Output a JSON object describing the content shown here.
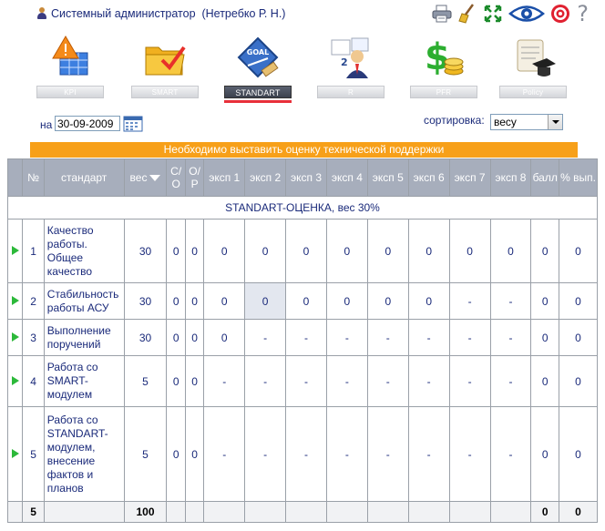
{
  "header": {
    "user_text": "Системный администратор  (Нетребко Р. Н.)",
    "tools": [
      "printer-icon",
      "broom-icon",
      "expand-icon",
      "eye-icon",
      "target-icon",
      "help-icon"
    ],
    "help_label": "?"
  },
  "modules": [
    {
      "label": "KPI",
      "icon": "warning-table-icon",
      "active": false
    },
    {
      "label": "SMART",
      "icon": "folder-check-icon",
      "active": false
    },
    {
      "label": "STANDART",
      "icon": "goal-sign-icon",
      "active": true
    },
    {
      "label": "R",
      "icon": "team-icon",
      "active": false
    },
    {
      "label": "PFR",
      "icon": "dollar-coins-icon",
      "active": false
    },
    {
      "label": "Policy",
      "icon": "scroll-cap-icon",
      "active": false
    }
  ],
  "controls": {
    "date_prefix": "на",
    "date_value": "30-09-2009",
    "sort_label": "сортировка:",
    "sort_value": "весу"
  },
  "warning": "Необходимо выставить оценку технической поддержки",
  "table": {
    "headers": {
      "num": "№",
      "standard": "стандарт",
      "weight": "вес",
      "so": "С/\nО",
      "op": "О/\nР",
      "e1": "эксп 1",
      "e2": "эксп 2",
      "e3": "эксп 3",
      "e4": "эксп 4",
      "e5": "эксп 5",
      "e6": "эксп 6",
      "e7": "эксп 7",
      "e8": "эксп 8",
      "score": "балл",
      "pct": "% вып."
    },
    "section": "STANDART-ОЦЕНКА, вес 30%",
    "rows": [
      {
        "n": "1",
        "name": "Качество работы. Общее качество",
        "w": "30",
        "so": "0",
        "op": "0",
        "e": [
          "0",
          "0",
          "0",
          "0",
          "0",
          "0",
          "0",
          "0"
        ],
        "score": "0",
        "pct": "0"
      },
      {
        "n": "2",
        "name": "Стабильность работы АСУ",
        "w": "30",
        "so": "0",
        "op": "0",
        "e": [
          "0",
          "0",
          "0",
          "0",
          "0",
          "0",
          "-",
          "-"
        ],
        "score": "0",
        "pct": "0"
      },
      {
        "n": "3",
        "name": "Выполнение поручений",
        "w": "30",
        "so": "0",
        "op": "0",
        "e": [
          "0",
          "-",
          "-",
          "-",
          "-",
          "-",
          "-",
          "-"
        ],
        "score": "0",
        "pct": "0"
      },
      {
        "n": "4",
        "name": "Работа со SMART-модулем",
        "w": "5",
        "so": "0",
        "op": "0",
        "e": [
          "-",
          "-",
          "-",
          "-",
          "-",
          "-",
          "-",
          "-"
        ],
        "score": "0",
        "pct": "0"
      },
      {
        "n": "5",
        "name": "Работа со STANDART-модулем, внесение фактов и планов",
        "w": "5",
        "so": "0",
        "op": "0",
        "e": [
          "-",
          "-",
          "-",
          "-",
          "-",
          "-",
          "-",
          "-"
        ],
        "score": "0",
        "pct": "0"
      }
    ],
    "footer": {
      "count": "5",
      "weight_total": "100",
      "score_total": "0",
      "pct_total": "0"
    }
  }
}
